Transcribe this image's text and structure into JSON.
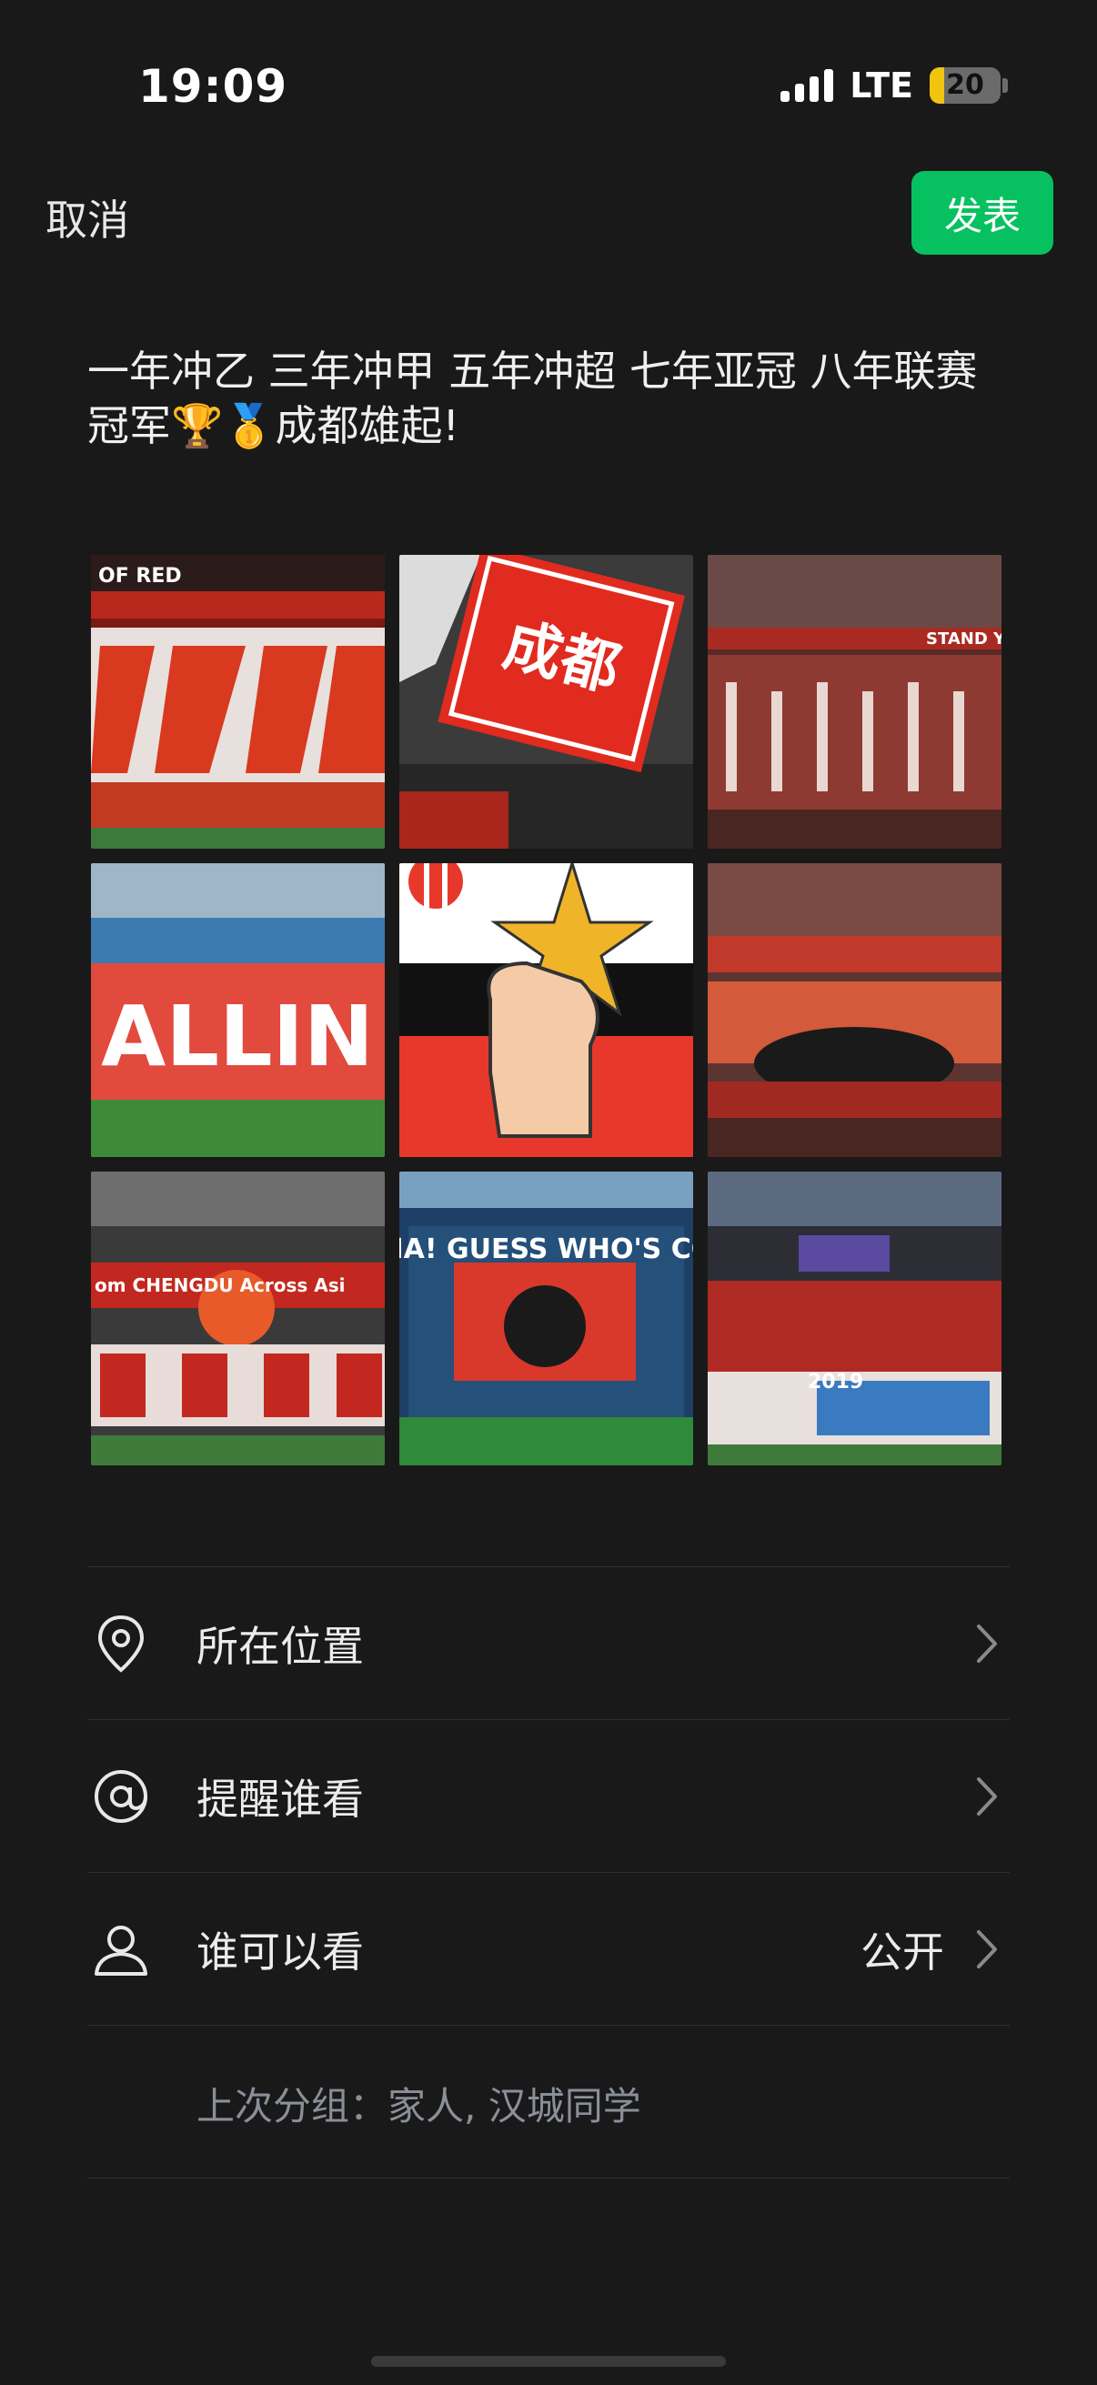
{
  "status_bar": {
    "time": "19:09",
    "network": "LTE",
    "battery": "20",
    "battery_level": 0.2
  },
  "nav": {
    "cancel_label": "取消",
    "publish_label": "发表"
  },
  "post": {
    "text": "一年冲乙 三年冲甲 五年冲超 七年亚冠 八年联赛冠军🏆🥇成都雄起!"
  },
  "images": [
    {
      "caption": "OF RED"
    },
    {
      "caption": "成都"
    },
    {
      "caption": "STAND YO"
    },
    {
      "caption": "ALLIN"
    },
    {
      "caption": ""
    },
    {
      "caption": ""
    },
    {
      "caption": "om CHENGDU Across Asi"
    },
    {
      "caption": "HEY!ASIA! GUESS WHO'S COMING?"
    },
    {
      "caption": "2019"
    }
  ],
  "menu": {
    "location": {
      "label": "所在位置",
      "icon": "location-pin-icon"
    },
    "remind": {
      "label": "提醒谁看",
      "icon": "at-icon"
    },
    "visibility": {
      "label": "谁可以看",
      "value": "公开",
      "icon": "person-icon"
    },
    "last_group": "上次分组：家人, 汉城同学"
  },
  "colors": {
    "accent": "#07c160",
    "background": "#191919",
    "muted_text": "#8a8f99"
  }
}
